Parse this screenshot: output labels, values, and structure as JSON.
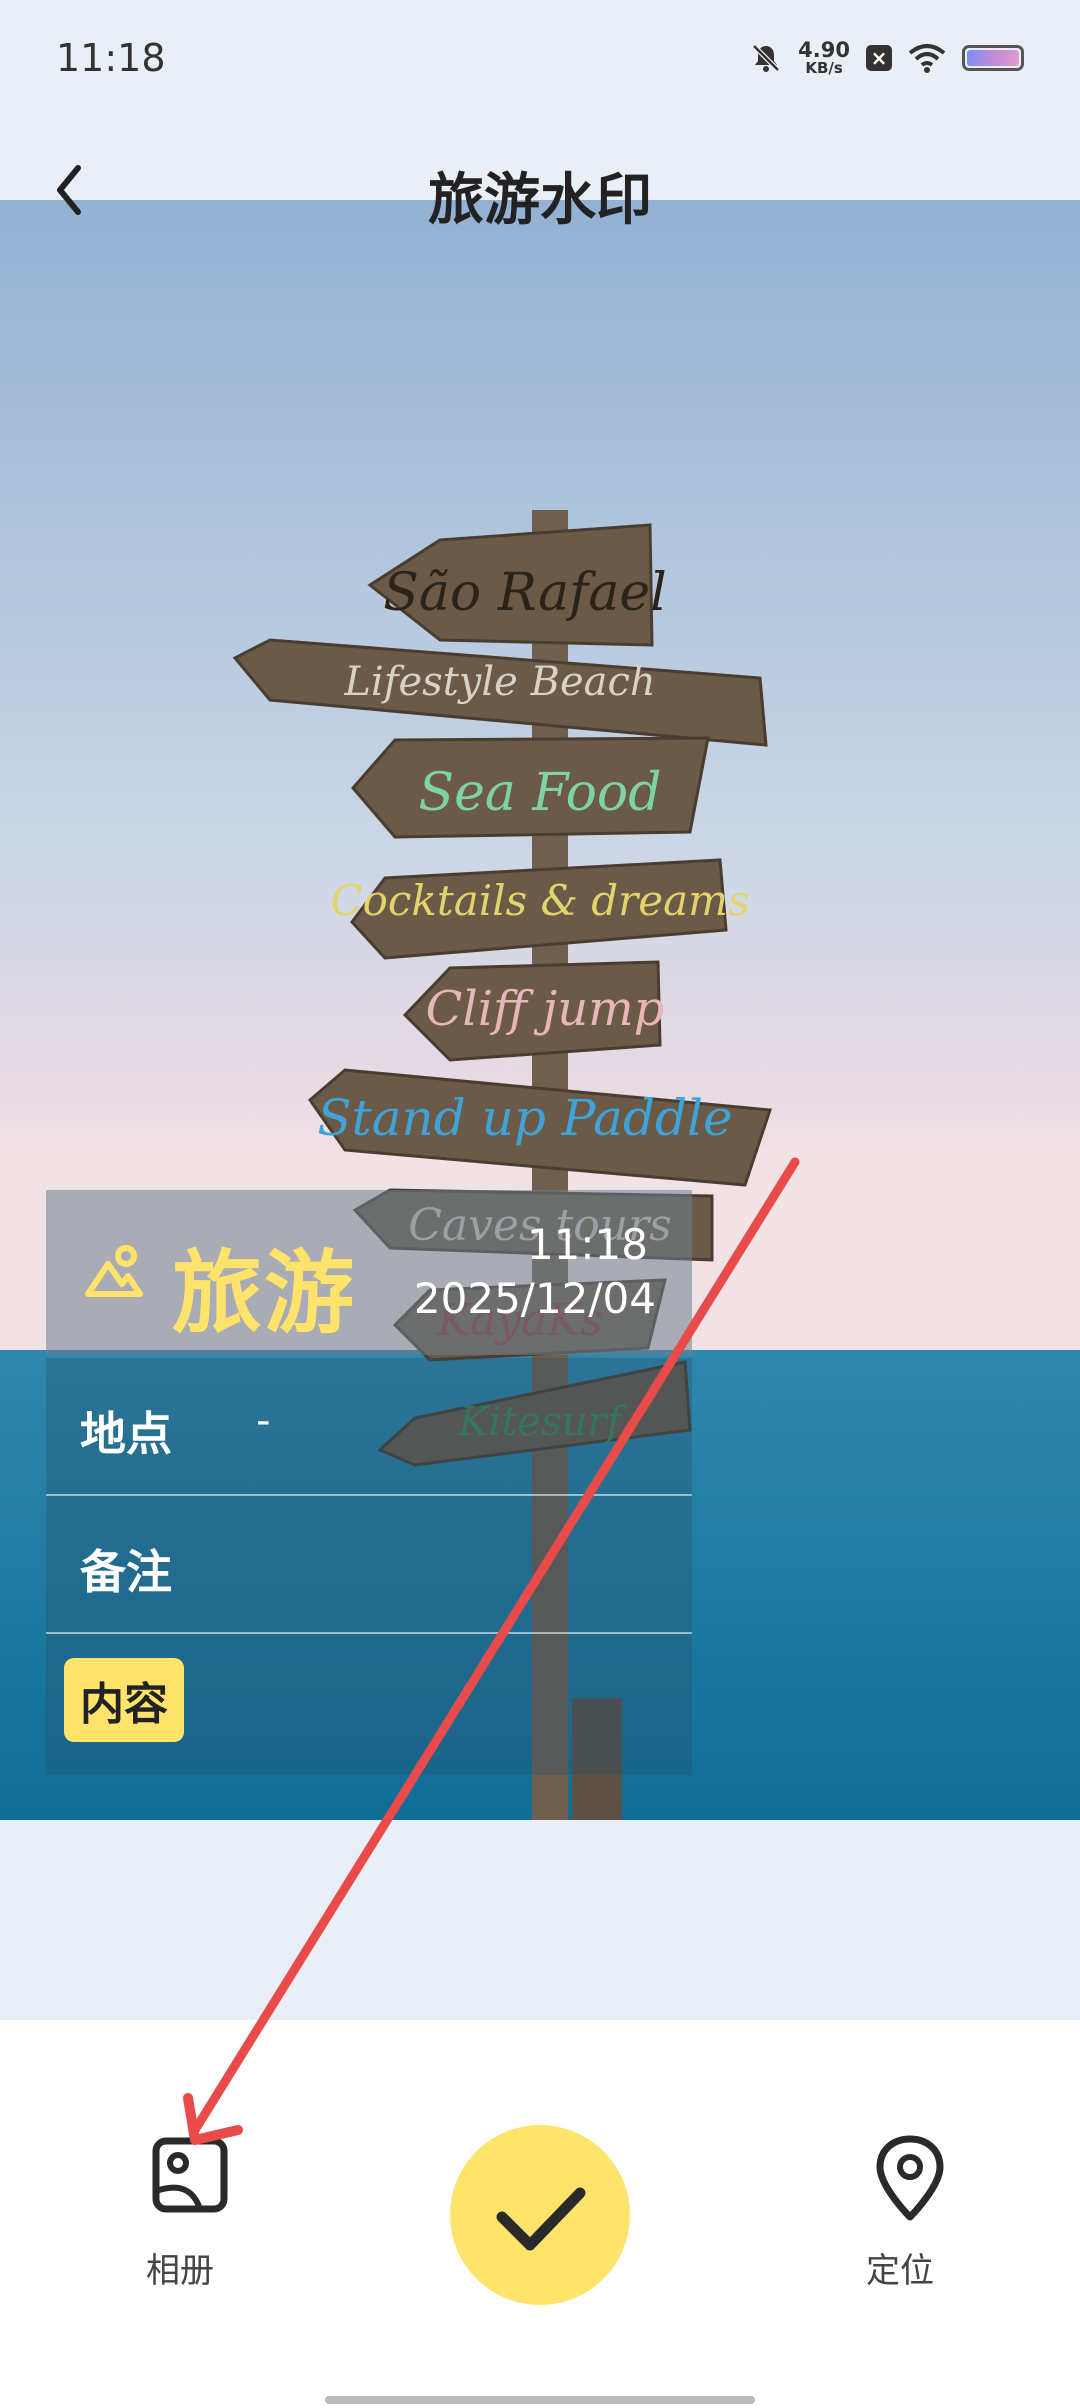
{
  "status_bar": {
    "time": "11:18",
    "net_speed_value": "4.90",
    "net_speed_unit": "KB/s",
    "icons": [
      "bell-muted-icon",
      "close-box-icon",
      "wifi-icon",
      "battery-icon"
    ]
  },
  "header": {
    "title": "旅游水印",
    "back_icon": "chevron-left-icon"
  },
  "photo": {
    "signs": [
      "São Rafael",
      "Lifestyle Beach",
      "Sea Food",
      "Cocktails & dreams",
      "Cliff jump",
      "Stand up Paddle",
      "Caves tours",
      "KayaKs",
      "Kitesurf"
    ]
  },
  "watermark": {
    "brand": "旅游",
    "time": "11:18",
    "date": "2025/12/04",
    "rows": [
      {
        "label": "地点",
        "value": "-"
      },
      {
        "label": "备注",
        "value": ""
      }
    ],
    "content_badge": "内容"
  },
  "bottom_bar": {
    "album_label": "相册",
    "location_label": "定位"
  },
  "colors": {
    "accent_yellow": "#ffe46c",
    "annotation_arrow": "#e94b4b"
  }
}
